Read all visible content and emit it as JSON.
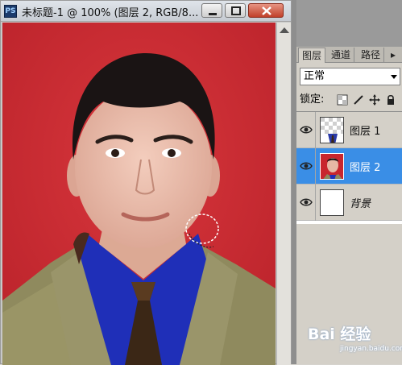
{
  "document": {
    "title": "未标题-1 @ 100% (图层 2, RGB/8...",
    "app_icon": "PS"
  },
  "window_controls": {
    "minimize_icon": "minimize-icon",
    "maximize_icon": "maximize-icon",
    "close_icon": "close-icon"
  },
  "layers_panel": {
    "tabs": [
      {
        "label": "图层",
        "active": true
      },
      {
        "label": "通道",
        "active": false
      },
      {
        "label": "路径",
        "active": false
      }
    ],
    "blend_mode": "正常",
    "lock_label": "锁定:",
    "lock_icons": [
      "lock-transparent-icon",
      "lock-brush-icon",
      "lock-move-icon",
      "lock-all-icon"
    ],
    "layers": [
      {
        "name": "图层 1",
        "visible": true,
        "selected": false,
        "thumbnail": "checkerboard-tie"
      },
      {
        "name": "图层 2",
        "visible": true,
        "selected": true,
        "thumbnail": "portrait-red"
      },
      {
        "name": "背景",
        "visible": true,
        "selected": false,
        "thumbnail": "white"
      }
    ]
  },
  "watermark": {
    "brand": "Bai 经验",
    "url": "jingyan.baidu.com"
  },
  "colors": {
    "canvas_background": "#cf2c33",
    "selected_layer": "#3a8ee6"
  }
}
